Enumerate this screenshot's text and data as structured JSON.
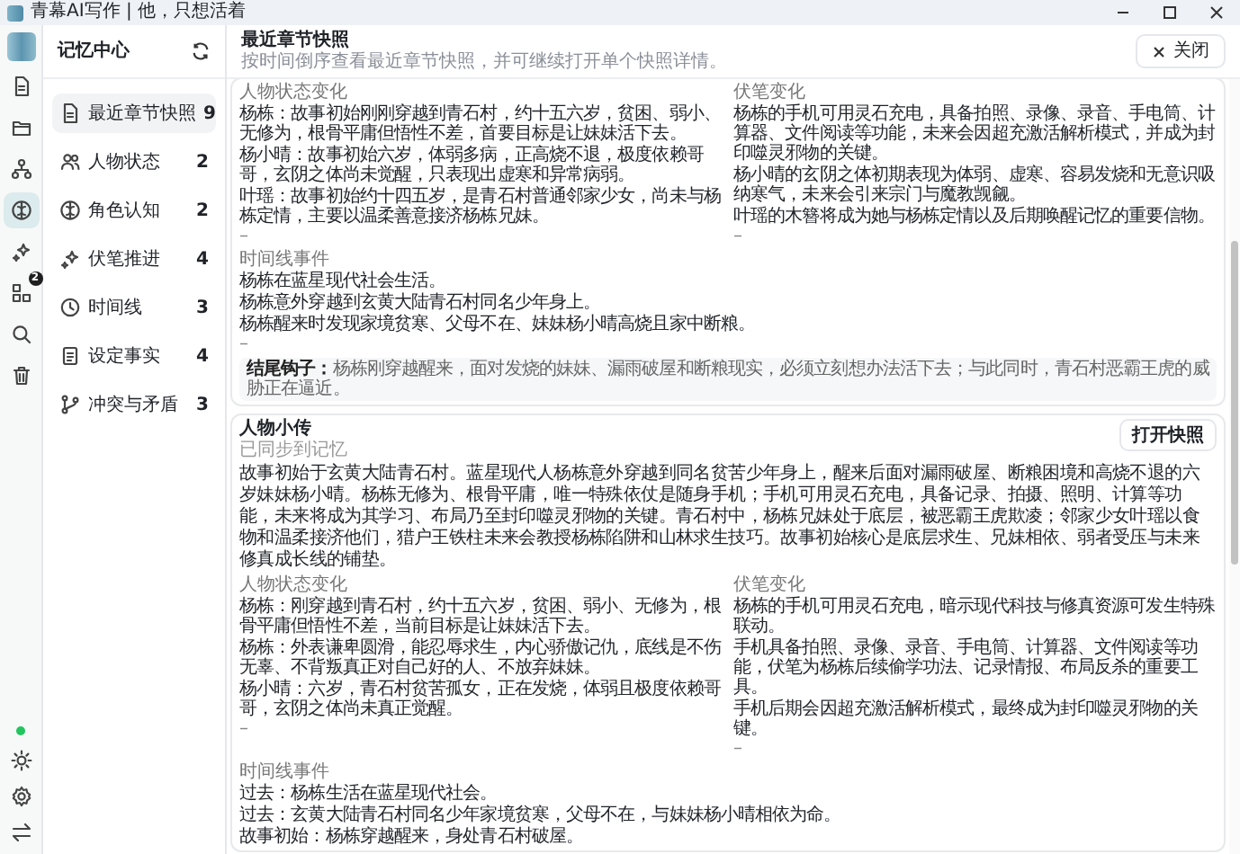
{
  "window": {
    "title": "青幕AI写作 | 他，只想活着"
  },
  "rail": {
    "items": [
      {
        "kind": "document",
        "selected": false
      },
      {
        "kind": "folder",
        "selected": false
      },
      {
        "kind": "network",
        "selected": false
      },
      {
        "kind": "brain",
        "selected": true
      },
      {
        "kind": "sparkles",
        "selected": false
      },
      {
        "kind": "apps",
        "selected": false,
        "badge": "2"
      },
      {
        "kind": "search",
        "selected": false
      },
      {
        "kind": "trash",
        "selected": false
      }
    ],
    "bottom": [
      {
        "kind": "status"
      },
      {
        "kind": "sun"
      },
      {
        "kind": "gear"
      },
      {
        "kind": "swap"
      }
    ]
  },
  "sidebar": {
    "title": "记忆中心",
    "items": [
      {
        "label": "最近章节快照",
        "count": "9",
        "selected": true
      },
      {
        "label": "人物状态",
        "count": "2",
        "selected": false
      },
      {
        "label": "角色认知",
        "count": "2",
        "selected": false
      },
      {
        "label": "伏笔推进",
        "count": "4",
        "selected": false
      },
      {
        "label": "时间线",
        "count": "3",
        "selected": false
      },
      {
        "label": "设定事实",
        "count": "4",
        "selected": false
      },
      {
        "label": "冲突与矛盾",
        "count": "3",
        "selected": false
      }
    ]
  },
  "panel": {
    "title": "最近章节快照",
    "subtitle": "按时间倒序查看最近章节快照，并可继续打开单个快照详情。",
    "close_button": "关闭"
  },
  "snapshots": [
    {
      "columns": [
        {
          "heading": "人物状态变化",
          "items": [
            "杨栋：故事初始刚刚穿越到青石村，约十五六岁，贫困、弱小、无修为，根骨平庸但悟性不差，首要目标是让妹妹活下去。",
            "杨小晴：故事初始六岁，体弱多病，正高烧不退，极度依赖哥哥，玄阴之体尚未觉醒，只表现出虚寒和异常病弱。",
            "叶瑶：故事初始约十四五岁，是青石村普通邻家少女，尚未与杨栋定情，主要以温柔善意接济杨栋兄妹。"
          ],
          "end_mark": "–"
        },
        {
          "heading": "伏笔变化",
          "items": [
            "杨栋的手机可用灵石充电，具备拍照、录像、录音、手电筒、计算器、文件阅读等功能，未来会因超充激活解析模式，并成为封印噬灵邪物的关键。",
            "杨小晴的玄阴之体初期表现为体弱、虚寒、容易发烧和无意识吸纳寒气，未来会引来宗门与魔教觊觎。",
            "叶瑶的木簪将成为她与杨栋定情以及后期唤醒记忆的重要信物。"
          ],
          "end_mark": "–"
        }
      ],
      "timeline": {
        "heading": "时间线事件",
        "items": [
          "杨栋在蓝星现代社会生活。",
          "杨栋意外穿越到玄黄大陆青石村同名少年身上。",
          "杨栋醒来时发现家境贫寒、父母不在、妹妹杨小晴高烧且家中断粮。"
        ],
        "end_mark": "–"
      },
      "hook": {
        "label": "结尾钩子：",
        "text": "杨栋刚穿越醒来，面对发烧的妹妹、漏雨破屋和断粮现实，必须立刻想办法活下去；与此同时，青石村恶霸王虎的威胁正在逼近。"
      }
    },
    {
      "title": "人物小传",
      "sync_status": "已同步到记忆",
      "open_button": "打开快照",
      "summary": "故事初始于玄黄大陆青石村。蓝星现代人杨栋意外穿越到同名贫苦少年身上，醒来后面对漏雨破屋、断粮困境和高烧不退的六岁妹妹杨小晴。杨栋无修为、根骨平庸，唯一特殊依仗是随身手机；手机可用灵石充电，具备记录、拍摄、照明、计算等功能，未来将成为其学习、布局乃至封印噬灵邪物的关键。青石村中，杨栋兄妹处于底层，被恶霸王虎欺凌；邻家少女叶瑶以食物和温柔接济他们，猎户王铁柱未来会教授杨栋陷阱和山林求生技巧。故事初始核心是底层求生、兄妹相依、弱者受压与未来修真成长线的铺垫。",
      "columns": [
        {
          "heading": "人物状态变化",
          "items": [
            "杨栋：刚穿越到青石村，约十五六岁，贫困、弱小、无修为，根骨平庸但悟性不差，当前目标是让妹妹活下去。",
            "杨栋：外表谦卑圆滑，能忍辱求生，内心骄傲记仇，底线是不伤无辜、不背叛真正对自己好的人、不放弃妹妹。",
            "杨小晴：六岁，青石村贫苦孤女，正在发烧，体弱且极度依赖哥哥，玄阴之体尚未真正觉醒。"
          ],
          "end_mark": "–"
        },
        {
          "heading": "伏笔变化",
          "items": [
            "杨栋的手机可用灵石充电，暗示现代科技与修真资源可发生特殊联动。",
            "手机具备拍照、录像、录音、手电筒、计算器、文件阅读等功能，伏笔为杨栋后续偷学功法、记录情报、布局反杀的重要工具。",
            "手机后期会因超充激活解析模式，最终成为封印噬灵邪物的关键。"
          ],
          "end_mark": "–"
        }
      ],
      "timeline": {
        "heading": "时间线事件",
        "items": [
          "过去：杨栋生活在蓝星现代社会。",
          "过去：玄黄大陆青石村同名少年家境贫寒，父母不在，与妹妹杨小晴相依为命。",
          "故事初始：杨栋穿越醒来，身处青石村破屋。"
        ]
      }
    }
  ]
}
